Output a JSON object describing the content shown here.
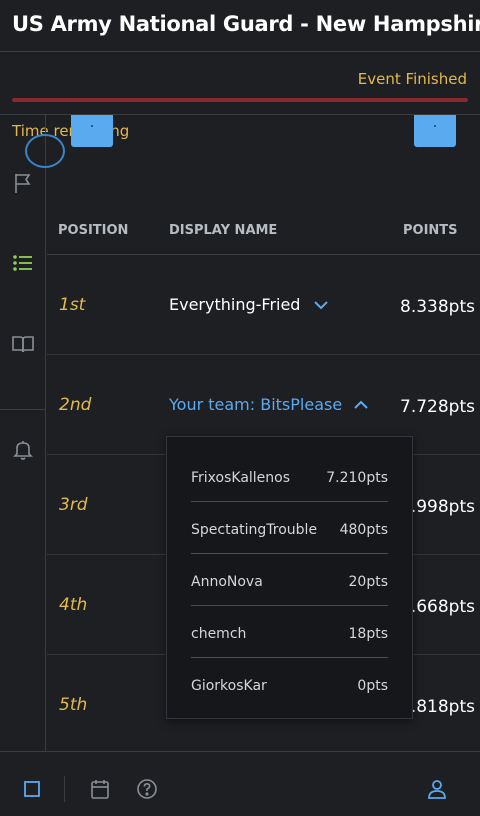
{
  "header": {
    "title": "US Army National Guard - New Hampshire B"
  },
  "timer": {
    "label": "Time remaining",
    "status": "Event Finished",
    "progress_fraction": 1.0,
    "colors": {
      "label": "#e3b94a",
      "bar": "#8a2830"
    }
  },
  "sidebar": {
    "items": [
      {
        "icon": "flag-icon",
        "active": false
      },
      {
        "icon": "list-icon",
        "active": true
      },
      {
        "icon": "book-icon",
        "active": false
      },
      {
        "icon": "bell-icon",
        "active": false
      }
    ]
  },
  "table": {
    "headers": {
      "position": "POSITION",
      "display_name": "DISPLAY NAME",
      "points": "POINTS"
    },
    "rows": [
      {
        "position": "1st",
        "name": "Everything-Fried",
        "points": "8.338pts",
        "expanded": false,
        "mine": false
      },
      {
        "position": "2nd",
        "name": "Your team: BitsPlease",
        "points": "7.728pts",
        "expanded": true,
        "mine": true
      },
      {
        "position": "3rd",
        "name": "",
        "points": ".998pts"
      },
      {
        "position": "4th",
        "name": "",
        "points": ".668pts"
      },
      {
        "position": "5th",
        "name": "",
        "points": ".818pts"
      }
    ]
  },
  "team_members": [
    {
      "name": "FrixosKallenos",
      "points": "7.210pts"
    },
    {
      "name": "SpectatingTrouble",
      "points": "480pts"
    },
    {
      "name": "AnnoNova",
      "points": "20pts"
    },
    {
      "name": "chemch",
      "points": "18pts"
    },
    {
      "name": "GiorkosKar",
      "points": "0pts"
    }
  ],
  "bottom_bar": {
    "icons": [
      "square-icon",
      "calendar-icon",
      "help-icon",
      "user-icon"
    ]
  },
  "colors": {
    "accent": "#5aaaf0",
    "gold": "#e3b94a",
    "active_green": "#8fd14f",
    "background": "#1d1f23"
  }
}
